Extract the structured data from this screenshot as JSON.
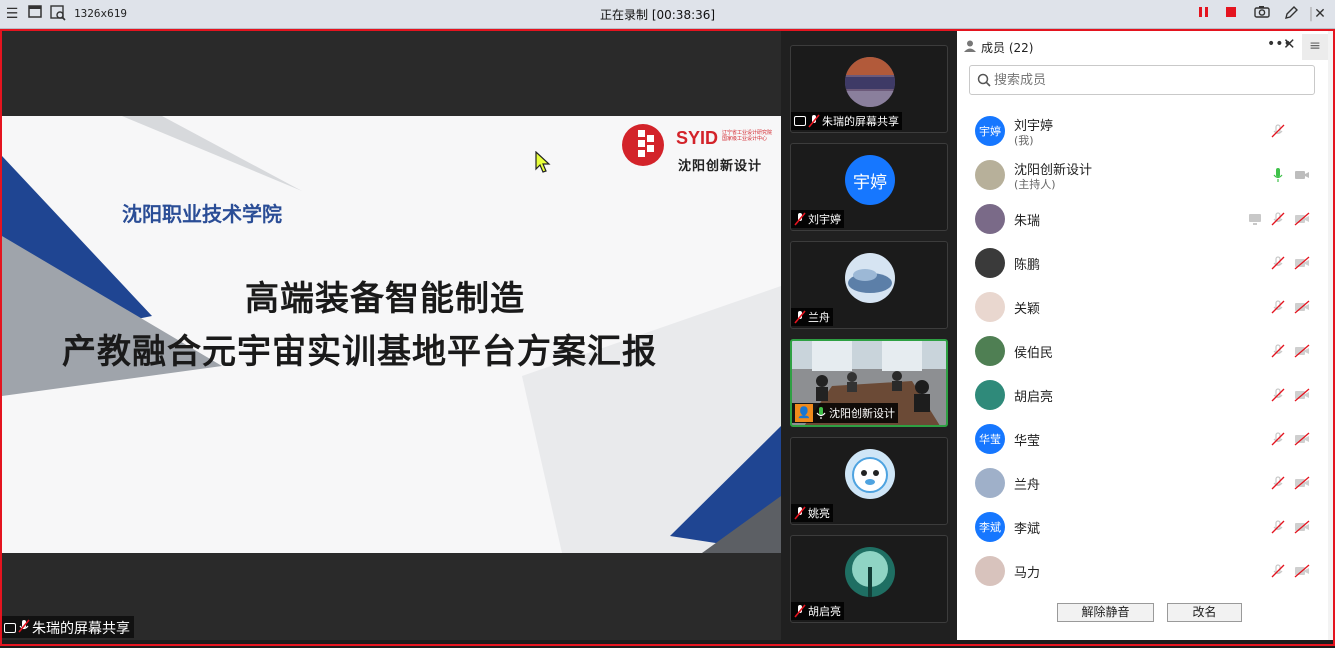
{
  "window": {
    "dims": "1326x619",
    "recording": "正在录制 [00:38:36]"
  },
  "slide": {
    "school": "沈阳职业技术学院",
    "title_line1": "高端装备智能制造",
    "title_line2": "产教融合元宇宙实训基地平台方案汇报",
    "logo_brand": "SYID",
    "logo_sub": "辽宁省工业设计研究院 国家级工业设计中心",
    "logo_cn": "沈阳创新设计"
  },
  "share_label": "朱瑞的屏幕共享",
  "video_tiles": [
    {
      "label": "朱瑞的屏幕共享",
      "avatar": "photo-icon",
      "sharing": true,
      "mic": "muted"
    },
    {
      "label": "刘宇婷",
      "avatar_text": "宇婷",
      "mic": "muted"
    },
    {
      "label": "兰舟",
      "avatar": "landscape-icon",
      "mic": "muted"
    },
    {
      "label": "沈阳创新设计",
      "avatar": "meeting-room-video",
      "mic": "active",
      "speaker": true
    },
    {
      "label": "姚亮",
      "avatar": "cartoon-icon",
      "mic": "muted"
    },
    {
      "label": "胡启亮",
      "avatar": "nature-icon",
      "mic": "muted"
    }
  ],
  "panel": {
    "title": "成员 (22)",
    "search_placeholder": "搜索成员",
    "members": [
      {
        "name": "刘宇婷",
        "role": "(我)",
        "avatar_text": "宇婷",
        "avatar_color": "#1677ff",
        "mic": "muted",
        "cam": "none"
      },
      {
        "name": "沈阳创新设计",
        "role": "(主持人)",
        "avatar_color": "#b7b09a",
        "mic": "on",
        "cam": "off-gray"
      },
      {
        "name": "朱瑞",
        "avatar_color": "#7a6a88",
        "mic": "muted",
        "cam": "muted",
        "share": true
      },
      {
        "name": "陈鹏",
        "avatar_color": "#3a3a3a",
        "mic": "muted",
        "cam": "muted"
      },
      {
        "name": "关颖",
        "avatar_color": "#e9d7cf",
        "mic": "muted",
        "cam": "muted"
      },
      {
        "name": "侯伯民",
        "avatar_color": "#4f7f53",
        "mic": "muted",
        "cam": "muted"
      },
      {
        "name": "胡启亮",
        "avatar_color": "#2f8a7a",
        "mic": "muted",
        "cam": "muted"
      },
      {
        "name": "华莹",
        "avatar_text": "华莹",
        "avatar_color": "#1677ff",
        "mic": "muted",
        "cam": "muted"
      },
      {
        "name": "兰舟",
        "avatar_color": "#9fb0c9",
        "mic": "muted",
        "cam": "muted"
      },
      {
        "name": "李斌",
        "avatar_text": "李斌",
        "avatar_color": "#1677ff",
        "mic": "muted",
        "cam": "muted"
      },
      {
        "name": "马力",
        "avatar_color": "#d8c3bd",
        "mic": "muted",
        "cam": "muted"
      }
    ],
    "unmute_button": "解除静音",
    "rename_button": "改名"
  }
}
